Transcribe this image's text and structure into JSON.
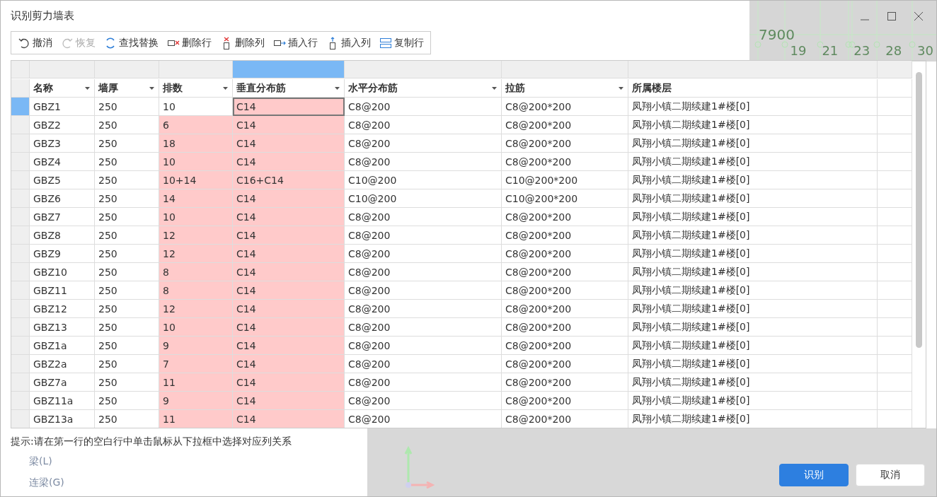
{
  "window": {
    "title": "识别剪力墙表"
  },
  "toolbar": [
    {
      "label": "撤消",
      "kind": "undo",
      "disabled": false
    },
    {
      "label": "恢复",
      "kind": "redo",
      "disabled": true
    },
    {
      "label": "查找替换",
      "kind": "find",
      "disabled": false
    },
    {
      "label": "删除行",
      "kind": "delrow",
      "disabled": false
    },
    {
      "label": "删除列",
      "kind": "delcol",
      "disabled": false
    },
    {
      "label": "插入行",
      "kind": "insrow",
      "disabled": false
    },
    {
      "label": "插入列",
      "kind": "inscol",
      "disabled": false
    },
    {
      "label": "复制行",
      "kind": "copyrow",
      "disabled": false
    }
  ],
  "background": {
    "dimension": "7900",
    "axes": [
      "19",
      "21",
      "23",
      "28",
      "30"
    ],
    "items": [
      "梁(L)",
      "连梁(G)"
    ]
  },
  "table": {
    "columns": [
      {
        "label": "名称",
        "selected": false,
        "dropdown": true
      },
      {
        "label": "墙厚",
        "selected": false,
        "dropdown": true
      },
      {
        "label": "排数",
        "selected": false,
        "dropdown": true
      },
      {
        "label": "垂直分布筋",
        "selected": true,
        "dropdown": true
      },
      {
        "label": "水平分布筋",
        "selected": false,
        "dropdown": true
      },
      {
        "label": "拉筋",
        "selected": false,
        "dropdown": true
      },
      {
        "label": "所属楼层",
        "selected": false,
        "dropdown": false
      }
    ],
    "rows": [
      {
        "selected": true,
        "cells": [
          "GBZ1",
          "250",
          "10",
          "C14",
          "C8@200",
          "C8@200*200",
          "凤翔小镇二期续建1#楼[0]"
        ],
        "marked": [
          false,
          false,
          false,
          true,
          false,
          false,
          false
        ],
        "focused": [
          false,
          false,
          false,
          true,
          false,
          false,
          false
        ]
      },
      {
        "selected": false,
        "cells": [
          "GBZ2",
          "250",
          "6",
          "C14",
          "C8@200",
          "C8@200*200",
          "凤翔小镇二期续建1#楼[0]"
        ],
        "marked": [
          false,
          false,
          true,
          true,
          false,
          false,
          false
        ]
      },
      {
        "selected": false,
        "cells": [
          "GBZ3",
          "250",
          "18",
          "C14",
          "C8@200",
          "C8@200*200",
          "凤翔小镇二期续建1#楼[0]"
        ],
        "marked": [
          false,
          false,
          true,
          true,
          false,
          false,
          false
        ]
      },
      {
        "selected": false,
        "cells": [
          "GBZ4",
          "250",
          "10",
          "C14",
          "C8@200",
          "C8@200*200",
          "凤翔小镇二期续建1#楼[0]"
        ],
        "marked": [
          false,
          false,
          true,
          true,
          false,
          false,
          false
        ]
      },
      {
        "selected": false,
        "cells": [
          "GBZ5",
          "250",
          "10+14",
          "C16+C14",
          "C10@200",
          "C10@200*200",
          "凤翔小镇二期续建1#楼[0]"
        ],
        "marked": [
          false,
          false,
          true,
          true,
          false,
          false,
          false
        ]
      },
      {
        "selected": false,
        "cells": [
          "GBZ6",
          "250",
          "14",
          "C14",
          "C10@200",
          "C10@200*200",
          "凤翔小镇二期续建1#楼[0]"
        ],
        "marked": [
          false,
          false,
          true,
          true,
          false,
          false,
          false
        ]
      },
      {
        "selected": false,
        "cells": [
          "GBZ7",
          "250",
          "10",
          "C14",
          "C8@200",
          "C8@200*200",
          "凤翔小镇二期续建1#楼[0]"
        ],
        "marked": [
          false,
          false,
          true,
          true,
          false,
          false,
          false
        ]
      },
      {
        "selected": false,
        "cells": [
          "GBZ8",
          "250",
          "12",
          "C14",
          "C8@200",
          "C8@200*200",
          "凤翔小镇二期续建1#楼[0]"
        ],
        "marked": [
          false,
          false,
          true,
          true,
          false,
          false,
          false
        ]
      },
      {
        "selected": false,
        "cells": [
          "GBZ9",
          "250",
          "12",
          "C14",
          "C8@200",
          "C8@200*200",
          "凤翔小镇二期续建1#楼[0]"
        ],
        "marked": [
          false,
          false,
          true,
          true,
          false,
          false,
          false
        ]
      },
      {
        "selected": false,
        "cells": [
          "GBZ10",
          "250",
          "8",
          "C14",
          "C8@200",
          "C8@200*200",
          "凤翔小镇二期续建1#楼[0]"
        ],
        "marked": [
          false,
          false,
          true,
          true,
          false,
          false,
          false
        ]
      },
      {
        "selected": false,
        "cells": [
          "GBZ11",
          "250",
          "8",
          "C14",
          "C8@200",
          "C8@200*200",
          "凤翔小镇二期续建1#楼[0]"
        ],
        "marked": [
          false,
          false,
          true,
          true,
          false,
          false,
          false
        ]
      },
      {
        "selected": false,
        "cells": [
          "GBZ12",
          "250",
          "12",
          "C14",
          "C8@200",
          "C8@200*200",
          "凤翔小镇二期续建1#楼[0]"
        ],
        "marked": [
          false,
          false,
          true,
          true,
          false,
          false,
          false
        ]
      },
      {
        "selected": false,
        "cells": [
          "GBZ13",
          "250",
          "10",
          "C14",
          "C8@200",
          "C8@200*200",
          "凤翔小镇二期续建1#楼[0]"
        ],
        "marked": [
          false,
          false,
          true,
          true,
          false,
          false,
          false
        ]
      },
      {
        "selected": false,
        "cells": [
          "GBZ1a",
          "250",
          "9",
          "C14",
          "C8@200",
          "C8@200*200",
          "凤翔小镇二期续建1#楼[0]"
        ],
        "marked": [
          false,
          false,
          true,
          true,
          false,
          false,
          false
        ]
      },
      {
        "selected": false,
        "cells": [
          "GBZ2a",
          "250",
          "7",
          "C14",
          "C8@200",
          "C8@200*200",
          "凤翔小镇二期续建1#楼[0]"
        ],
        "marked": [
          false,
          false,
          true,
          true,
          false,
          false,
          false
        ]
      },
      {
        "selected": false,
        "cells": [
          "GBZ7a",
          "250",
          "11",
          "C14",
          "C8@200",
          "C8@200*200",
          "凤翔小镇二期续建1#楼[0]"
        ],
        "marked": [
          false,
          false,
          true,
          true,
          false,
          false,
          false
        ]
      },
      {
        "selected": false,
        "cells": [
          "GBZ11a",
          "250",
          "9",
          "C14",
          "C8@200",
          "C8@200*200",
          "凤翔小镇二期续建1#楼[0]"
        ],
        "marked": [
          false,
          false,
          true,
          true,
          false,
          false,
          false
        ]
      },
      {
        "selected": false,
        "cells": [
          "GBZ13a",
          "250",
          "11",
          "C14",
          "C8@200",
          "C8@200*200",
          "凤翔小镇二期续建1#楼[0]"
        ],
        "marked": [
          false,
          false,
          true,
          true,
          false,
          false,
          false
        ]
      }
    ]
  },
  "hint": "提示:请在第一行的空白行中单击鼠标从下拉框中选择对应列关系",
  "buttons": [
    {
      "label": "识别",
      "primary": true
    },
    {
      "label": "取消",
      "primary": false
    }
  ]
}
